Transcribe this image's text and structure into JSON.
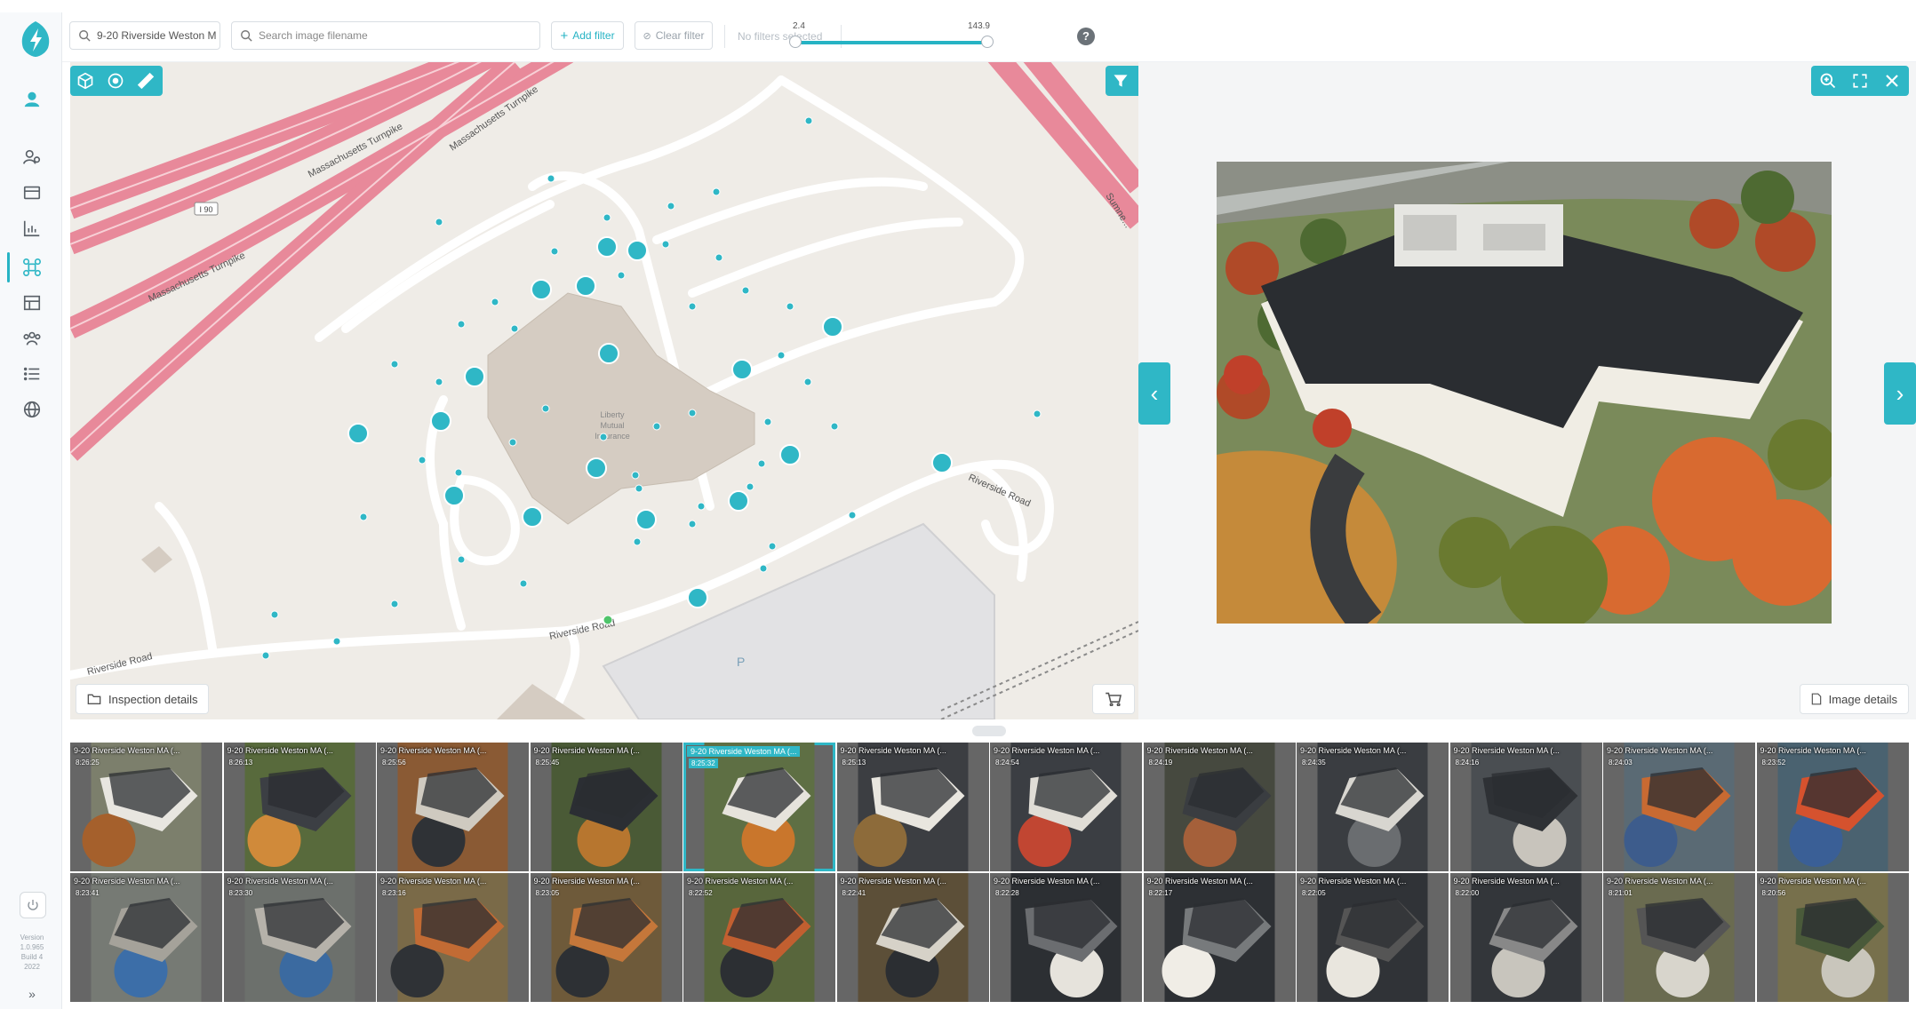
{
  "topbar": {
    "inspection_select": "9-20 Riverside Weston M",
    "search_placeholder": "Search image filename",
    "add_filter": "Add filter",
    "clear_filter": "Clear filter",
    "filter_status": "No filters selected",
    "range_min": "2.4",
    "range_max": "143.9",
    "help": "?"
  },
  "map": {
    "roads": [
      "Massachusetts Turnpike",
      "Massachusetts Turnpike",
      "Massachusetts Turnpike",
      "Riverside Road",
      "Riverside Road",
      "Riverside Road",
      "Sumne..."
    ],
    "route_shield": "I 90",
    "building_label": [
      "Liberty",
      "Mutual",
      "Insurance"
    ],
    "parking_label": "P",
    "inspection_details": "Inspection details"
  },
  "viewer": {
    "image_details": "Image details"
  },
  "leftnav": {
    "version": [
      "Version",
      "1.0.965",
      "Build 4",
      "2022"
    ]
  },
  "thumbnails": [
    {
      "caption": "9-20 Riverside Weston MA (...",
      "time": "8:26:25"
    },
    {
      "caption": "9-20 Riverside Weston MA (...",
      "time": "8:26:13"
    },
    {
      "caption": "9-20 Riverside Weston MA (...",
      "time": "8:25:56"
    },
    {
      "caption": "9-20 Riverside Weston MA (...",
      "time": "8:25:45"
    },
    {
      "caption": "9-20 Riverside Weston MA (...",
      "time": "8:25:32"
    },
    {
      "caption": "9-20 Riverside Weston MA (...",
      "time": "8:25:13"
    },
    {
      "caption": "9-20 Riverside Weston MA (...",
      "time": "8:24:54"
    },
    {
      "caption": "9-20 Riverside Weston MA (...",
      "time": "8:24:19"
    },
    {
      "caption": "9-20 Riverside Weston MA (...",
      "time": "8:24:35"
    },
    {
      "caption": "9-20 Riverside Weston MA (...",
      "time": "8:24:16"
    },
    {
      "caption": "9-20 Riverside Weston MA (...",
      "time": "8:24:03"
    },
    {
      "caption": "9-20 Riverside Weston MA (...",
      "time": "8:23:52"
    },
    {
      "caption": "9-20 Riverside Weston MA (...",
      "time": "8:23:41"
    },
    {
      "caption": "9-20 Riverside Weston MA (...",
      "time": "8:23:30"
    },
    {
      "caption": "9-20 Riverside Weston MA (...",
      "time": "8:23:16"
    },
    {
      "caption": "9-20 Riverside Weston MA (...",
      "time": "8:23:05"
    },
    {
      "caption": "9-20 Riverside Weston MA (...",
      "time": "8:22:52"
    },
    {
      "caption": "9-20 Riverside Weston MA (...",
      "time": "8:22:41"
    },
    {
      "caption": "9-20 Riverside Weston MA (...",
      "time": "8:22:28"
    },
    {
      "caption": "9-20 Riverside Weston MA (...",
      "time": "8:22:17"
    },
    {
      "caption": "9-20 Riverside Weston MA (...",
      "time": "8:22:05"
    },
    {
      "caption": "9-20 Riverside Weston MA (...",
      "time": "8:22:00"
    },
    {
      "caption": "9-20 Riverside Weston MA (...",
      "time": "8:21:01"
    },
    {
      "caption": "9-20 Riverside Weston MA (...",
      "time": "8:20:56"
    }
  ],
  "colors": {
    "accent": "#2fb7c6",
    "highway": "#e8899a",
    "map_bg": "#efece7",
    "building": "#d5ccc2"
  },
  "icons": [
    "logo-bolt-icon",
    "user-icon",
    "users-icon",
    "card-icon",
    "chart-icon",
    "drone-icon",
    "table-icon",
    "people-icon",
    "list-icon",
    "globe-icon",
    "power-icon",
    "cube-icon",
    "target-icon",
    "ruler-icon",
    "funnel-icon",
    "circle-icon",
    "pencil-icon",
    "flag-icon",
    "zoom-icon",
    "expand-icon",
    "close-icon"
  ]
}
